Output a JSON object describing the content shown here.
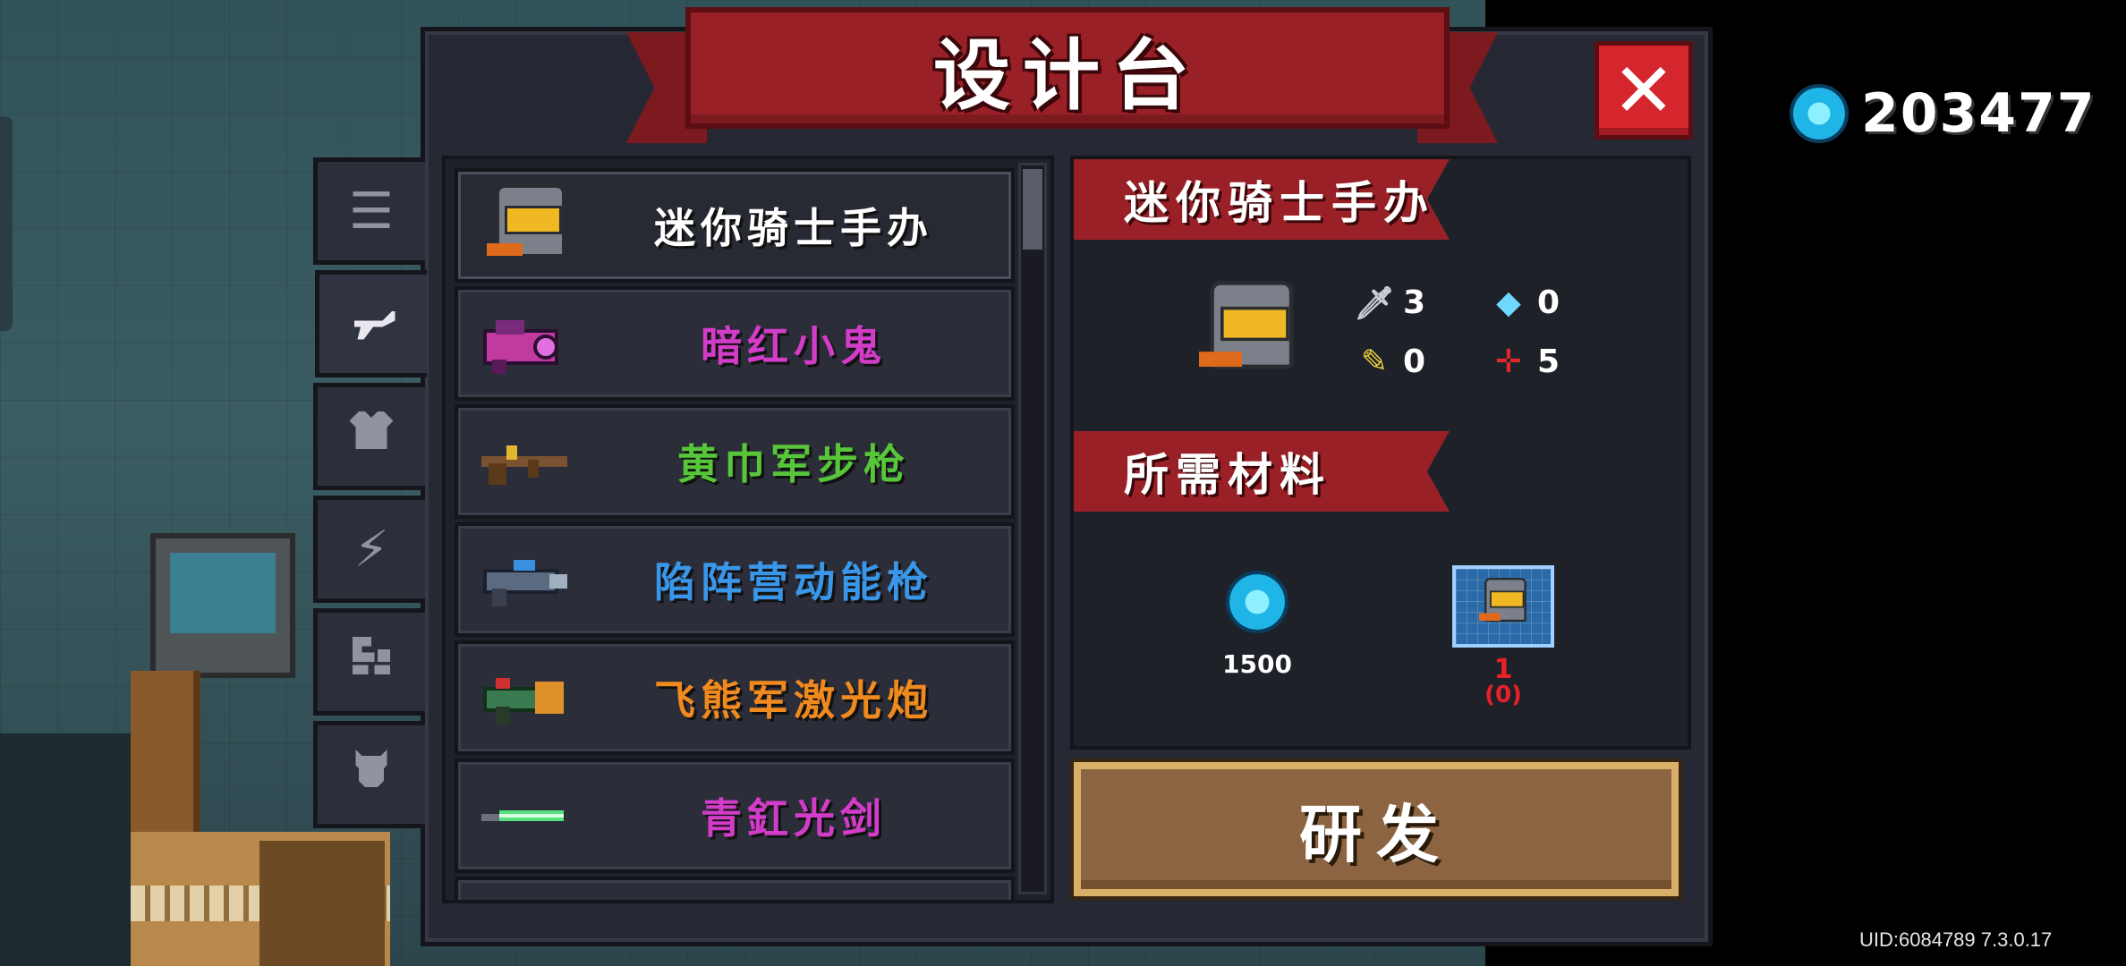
{
  "dialog": {
    "title": "设计台",
    "close_icon": "close-x-icon"
  },
  "currency": {
    "icon": "gem-icon",
    "count": "203477"
  },
  "side_tabs": [
    {
      "icon": "list-icon",
      "active": false
    },
    {
      "icon": "gun-icon",
      "active": true
    },
    {
      "icon": "armor-icon",
      "active": false
    },
    {
      "icon": "lightning-icon",
      "active": false
    },
    {
      "icon": "tools-icon",
      "active": false
    },
    {
      "icon": "pet-icon",
      "active": false
    }
  ],
  "items": [
    {
      "name": "迷你骑士手办",
      "color": "#ffffff",
      "selected": true,
      "sprite": "mini-knight-figure-icon"
    },
    {
      "name": "暗红小鬼",
      "color": "#d23cc8",
      "selected": false,
      "sprite": "crimson-imp-gun-icon"
    },
    {
      "name": "黄巾军步枪",
      "color": "#58c63a",
      "selected": false,
      "sprite": "yellow-turban-rifle-icon"
    },
    {
      "name": "陷阵营动能枪",
      "color": "#3a96e8",
      "selected": false,
      "sprite": "kinetic-gun-icon"
    },
    {
      "name": "飞熊军激光炮",
      "color": "#f08a1e",
      "selected": false,
      "sprite": "laser-cannon-icon"
    },
    {
      "name": "青釭光剑",
      "color": "#d23cc8",
      "selected": false,
      "sprite": "light-sword-icon"
    }
  ],
  "detail": {
    "name": "迷你骑士手办",
    "stats": {
      "attack": "3",
      "energy": "0",
      "crit": "0",
      "accuracy": "5"
    },
    "materials_title": "所需材料",
    "materials": {
      "gems": "1500",
      "blueprint_required": "1",
      "blueprint_owned": "(0)"
    },
    "research_label": "研发"
  },
  "uid": "UID:6084789 7.3.0.17"
}
